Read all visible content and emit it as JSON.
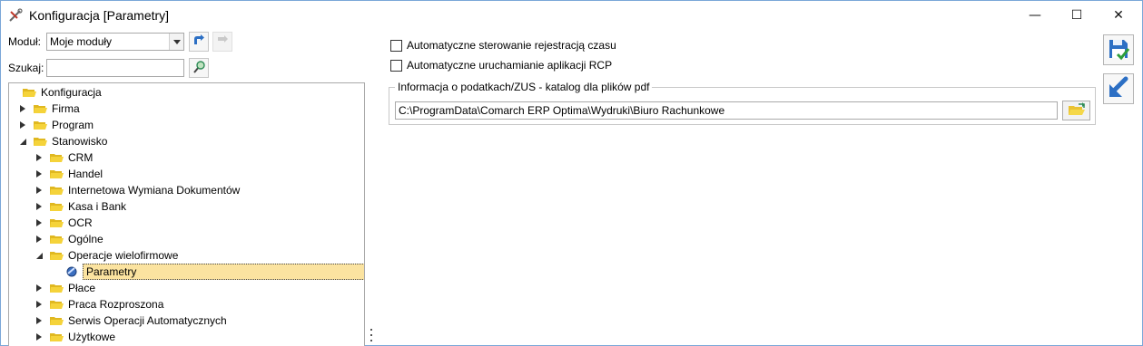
{
  "window": {
    "title": "Konfiguracja [Parametry]",
    "min_glyph": "—",
    "max_glyph": "☐",
    "close_glyph": "✕"
  },
  "module": {
    "label": "Moduł:",
    "selected": "Moje moduły"
  },
  "search": {
    "label": "Szukaj:",
    "value": "",
    "placeholder": ""
  },
  "tree": {
    "items": [
      {
        "label": "Konfiguracja",
        "level": 0,
        "expander": "none"
      },
      {
        "label": "Firma",
        "level": 1,
        "expander": "collapsed"
      },
      {
        "label": "Program",
        "level": 1,
        "expander": "collapsed"
      },
      {
        "label": "Stanowisko",
        "level": 1,
        "expander": "expanded"
      },
      {
        "label": "CRM",
        "level": 2,
        "expander": "collapsed"
      },
      {
        "label": "Handel",
        "level": 2,
        "expander": "collapsed"
      },
      {
        "label": "Internetowa Wymiana Dokumentów",
        "level": 2,
        "expander": "collapsed"
      },
      {
        "label": "Kasa i Bank",
        "level": 2,
        "expander": "collapsed"
      },
      {
        "label": "OCR",
        "level": 2,
        "expander": "collapsed"
      },
      {
        "label": "Ogólne",
        "level": 2,
        "expander": "collapsed"
      },
      {
        "label": "Operacje wielofirmowe",
        "level": 2,
        "expander": "expanded"
      },
      {
        "label": "Parametry",
        "level": 3,
        "expander": "none",
        "selected": true
      },
      {
        "label": "Płace",
        "level": 2,
        "expander": "collapsed"
      },
      {
        "label": "Praca Rozproszona",
        "level": 2,
        "expander": "collapsed"
      },
      {
        "label": "Serwis Operacji Automatycznych",
        "level": 2,
        "expander": "collapsed"
      },
      {
        "label": "Użytkowe",
        "level": 2,
        "expander": "collapsed"
      }
    ]
  },
  "options": {
    "auto_time_registration": "Automatyczne sterowanie rejestracją czasu",
    "auto_rcp_launch": "Automatyczne uruchamianie aplikacji RCP",
    "auto_time_registration_checked": false,
    "auto_rcp_launch_checked": false
  },
  "pdf_group": {
    "title": "Informacja o podatkach/ZUS - katalog dla plików pdf",
    "path": "C:\\ProgramData\\Comarch ERP Optima\\Wydruki\\Biuro Rachunkowe"
  },
  "colors": {
    "selection": "#fbe3a0",
    "folder": "#f5d33a",
    "accent_blue": "#2c6fc4",
    "window_border": "#7aa7d8"
  }
}
